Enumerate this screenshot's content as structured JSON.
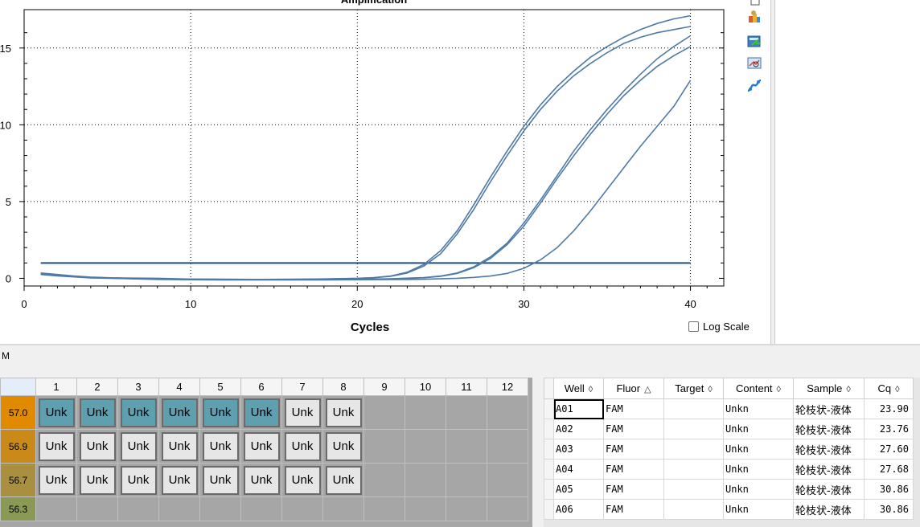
{
  "chart_data": {
    "type": "line",
    "title": "Amplification",
    "xlabel": "Cycles",
    "ylabel": "",
    "xlim": [
      0,
      42
    ],
    "ylim": [
      -0.5,
      17.5
    ],
    "x_ticks": [
      0,
      10,
      20,
      30,
      40
    ],
    "y_ticks": [
      0,
      5,
      10,
      15
    ],
    "grid": "dotted",
    "legend": "none",
    "threshold": 1.0,
    "series": [
      {
        "x": [
          1,
          2,
          3,
          4,
          5,
          6,
          8,
          10,
          12,
          14,
          16,
          18,
          20,
          21,
          22,
          23,
          24,
          25,
          26,
          27,
          28,
          29,
          30,
          31,
          32,
          33,
          34,
          35,
          36,
          37,
          38,
          39,
          40
        ],
        "y": [
          0.35,
          0.25,
          0.15,
          0.08,
          0.04,
          0.02,
          0.0,
          -0.05,
          -0.06,
          -0.07,
          -0.06,
          -0.04,
          0.0,
          0.05,
          0.15,
          0.4,
          0.9,
          1.8,
          3.1,
          4.8,
          6.6,
          8.3,
          9.9,
          11.3,
          12.5,
          13.5,
          14.4,
          15.1,
          15.7,
          16.2,
          16.6,
          16.9,
          17.1
        ]
      },
      {
        "x": [
          1,
          2,
          3,
          4,
          5,
          6,
          8,
          10,
          12,
          14,
          16,
          18,
          20,
          21,
          22,
          23,
          24,
          25,
          26,
          27,
          28,
          29,
          30,
          31,
          32,
          33,
          34,
          35,
          36,
          37,
          38,
          39,
          40
        ],
        "y": [
          0.3,
          0.2,
          0.12,
          0.06,
          0.03,
          0.01,
          -0.02,
          -0.06,
          -0.07,
          -0.08,
          -0.07,
          -0.05,
          -0.01,
          0.04,
          0.13,
          0.35,
          0.8,
          1.6,
          2.9,
          4.5,
          6.3,
          8.0,
          9.6,
          11.0,
          12.2,
          13.2,
          14.0,
          14.7,
          15.3,
          15.7,
          16.0,
          16.2,
          16.4
        ]
      },
      {
        "x": [
          1,
          2,
          4,
          6,
          8,
          10,
          12,
          14,
          16,
          18,
          20,
          22,
          24,
          25,
          26,
          27,
          28,
          29,
          30,
          31,
          32,
          33,
          34,
          35,
          36,
          37,
          38,
          39,
          40
        ],
        "y": [
          0.3,
          0.2,
          0.05,
          0.0,
          -0.05,
          -0.07,
          -0.08,
          -0.08,
          -0.08,
          -0.07,
          -0.06,
          -0.03,
          0.05,
          0.15,
          0.35,
          0.75,
          1.4,
          2.3,
          3.6,
          5.1,
          6.7,
          8.3,
          9.7,
          11.0,
          12.2,
          13.3,
          14.3,
          15.1,
          15.8
        ]
      },
      {
        "x": [
          1,
          2,
          4,
          6,
          8,
          10,
          12,
          14,
          16,
          18,
          20,
          22,
          24,
          25,
          26,
          27,
          28,
          29,
          30,
          31,
          32,
          33,
          34,
          35,
          36,
          37,
          38,
          39,
          40
        ],
        "y": [
          0.28,
          0.18,
          0.04,
          -0.01,
          -0.06,
          -0.08,
          -0.09,
          -0.09,
          -0.09,
          -0.08,
          -0.07,
          -0.04,
          0.04,
          0.13,
          0.32,
          0.7,
          1.3,
          2.2,
          3.4,
          4.9,
          6.5,
          8.0,
          9.4,
          10.7,
          11.9,
          12.9,
          13.8,
          14.5,
          15.1
        ]
      },
      {
        "x": [
          1,
          2,
          4,
          6,
          8,
          10,
          12,
          14,
          16,
          18,
          20,
          22,
          24,
          26,
          27,
          28,
          29,
          30,
          31,
          32,
          33,
          34,
          35,
          36,
          37,
          38,
          39,
          40
        ],
        "y": [
          0.25,
          0.16,
          0.03,
          -0.02,
          -0.07,
          -0.09,
          -0.1,
          -0.1,
          -0.1,
          -0.1,
          -0.09,
          -0.08,
          -0.06,
          0.0,
          0.06,
          0.15,
          0.32,
          0.65,
          1.2,
          2.0,
          3.1,
          4.4,
          5.8,
          7.2,
          8.6,
          9.9,
          11.2,
          12.9
        ]
      }
    ]
  },
  "toolbar_icons": [
    "copy-icon",
    "palette-icon",
    "export-icon",
    "zoom-icon",
    "curve-icon"
  ],
  "log_scale": {
    "label": "Log Scale",
    "checked": false
  },
  "mid_label": "M",
  "plate": {
    "columns": [
      "1",
      "2",
      "3",
      "4",
      "5",
      "6",
      "7",
      "8",
      "9",
      "10",
      "11",
      "12"
    ],
    "rows": [
      {
        "temp": "57.0",
        "color": "#e08a00",
        "wells": [
          "Unk",
          "Unk",
          "Unk",
          "Unk",
          "Unk",
          "Unk",
          "Unk",
          "Unk",
          "",
          "",
          "",
          ""
        ],
        "selected": [
          true,
          true,
          true,
          true,
          true,
          true,
          false,
          false
        ]
      },
      {
        "temp": "56.9",
        "color": "#c98a1a",
        "wells": [
          "Unk",
          "Unk",
          "Unk",
          "Unk",
          "Unk",
          "Unk",
          "Unk",
          "Unk",
          "",
          "",
          "",
          ""
        ],
        "selected": [
          false,
          false,
          false,
          false,
          false,
          false,
          false,
          false
        ]
      },
      {
        "temp": "56.7",
        "color": "#a89040",
        "wells": [
          "Unk",
          "Unk",
          "Unk",
          "Unk",
          "Unk",
          "Unk",
          "Unk",
          "Unk",
          "",
          "",
          "",
          ""
        ],
        "selected": [
          false,
          false,
          false,
          false,
          false,
          false,
          false,
          false
        ]
      },
      {
        "temp": "56.3",
        "color": "#8a9a55",
        "wells": [
          "",
          "",
          "",
          "",
          "",
          "",
          "",
          "",
          "",
          "",
          "",
          ""
        ],
        "selected": []
      }
    ]
  },
  "results": {
    "headers": [
      {
        "label": "Well",
        "sort": "◊"
      },
      {
        "label": "Fluor",
        "sort": "△"
      },
      {
        "label": "Target",
        "sort": "◊"
      },
      {
        "label": "Content",
        "sort": "◊"
      },
      {
        "label": "Sample",
        "sort": "◊"
      },
      {
        "label": "Cq",
        "sort": "◊"
      }
    ],
    "rows": [
      {
        "well": "A01",
        "fluor": "FAM",
        "target": "",
        "content": "Unkn",
        "sample": "轮枝状-液体",
        "cq": "23.90"
      },
      {
        "well": "A02",
        "fluor": "FAM",
        "target": "",
        "content": "Unkn",
        "sample": "轮枝状-液体",
        "cq": "23.76"
      },
      {
        "well": "A03",
        "fluor": "FAM",
        "target": "",
        "content": "Unkn",
        "sample": "轮枝状-液体",
        "cq": "27.60"
      },
      {
        "well": "A04",
        "fluor": "FAM",
        "target": "",
        "content": "Unkn",
        "sample": "轮枝状-液体",
        "cq": "27.68"
      },
      {
        "well": "A05",
        "fluor": "FAM",
        "target": "",
        "content": "Unkn",
        "sample": "轮枝状-液体",
        "cq": "30.86"
      },
      {
        "well": "A06",
        "fluor": "FAM",
        "target": "",
        "content": "Unkn",
        "sample": "轮枝状-液体",
        "cq": "30.86"
      }
    ]
  }
}
